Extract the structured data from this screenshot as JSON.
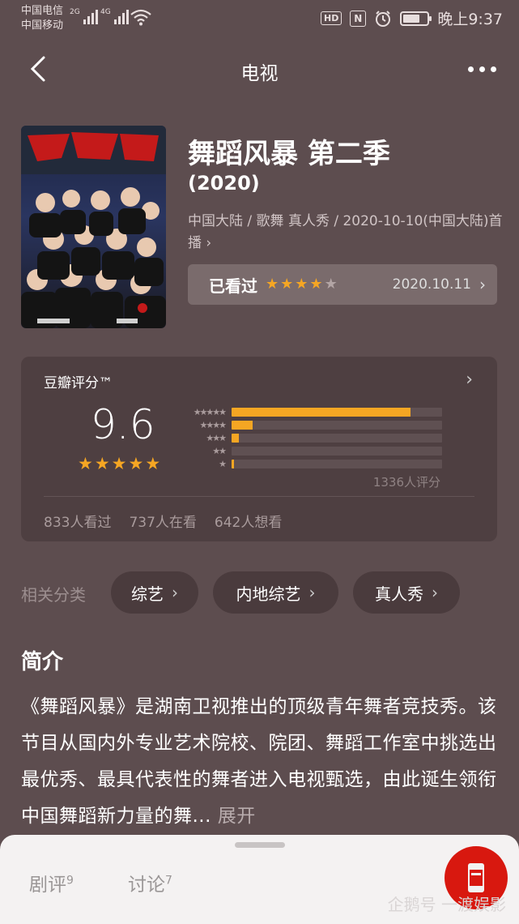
{
  "status_bar": {
    "carrier_1": "中国电信",
    "carrier_2": "中国移动",
    "net_1": "2G",
    "net_2": "4G",
    "hd": "HD",
    "nfc": "N",
    "time": "晚上9:37"
  },
  "nav": {
    "title": "电视"
  },
  "show": {
    "title": "舞蹈风暴 第二季",
    "year": "(2020)",
    "meta": "中国大陆 / 歌舞 真人秀 / 2020-10-10(中国大陆)首播",
    "meta_chevron": "›",
    "watched_label": "已看过",
    "user_rating": 4,
    "watched_date": "2020.10.11",
    "watched_chevron": "›"
  },
  "rating": {
    "title": "豆瓣评分™",
    "score": "9.6",
    "score_stars": 5,
    "distribution": [
      {
        "stars": 5,
        "fraction": 0.85
      },
      {
        "stars": 4,
        "fraction": 0.1
      },
      {
        "stars": 3,
        "fraction": 0.035
      },
      {
        "stars": 2,
        "fraction": 0.0
      },
      {
        "stars": 1,
        "fraction": 0.01
      }
    ],
    "votes": "1336人评分",
    "watched": "833人看过",
    "watching": "737人在看",
    "wish": "642人想看",
    "chevron": "›"
  },
  "categories": {
    "label": "相关分类",
    "items": [
      "综艺",
      "内地综艺",
      "真人秀"
    ],
    "chevron": "›"
  },
  "intro": {
    "heading": "简介",
    "body": "《舞蹈风暴》是湖南卫视推出的顶级青年舞者竞技秀。该节目从国内外专业艺术院校、院团、舞蹈工作室中挑选出最优秀、最具代表性的舞者进入电视甄选，由此诞生领衔中国舞蹈新力量的舞...",
    "expand": "展开"
  },
  "bottom_sheet": {
    "tab_reviews": "剧评",
    "tab_reviews_count": "9",
    "tab_discuss": "讨论",
    "tab_discuss_count": "7"
  },
  "watermark": "企鹅号 一渡娱影",
  "colors": {
    "background": "#5d4d4f",
    "card": "#4e3f41",
    "star": "#f5a623",
    "fab": "#d8180f"
  }
}
